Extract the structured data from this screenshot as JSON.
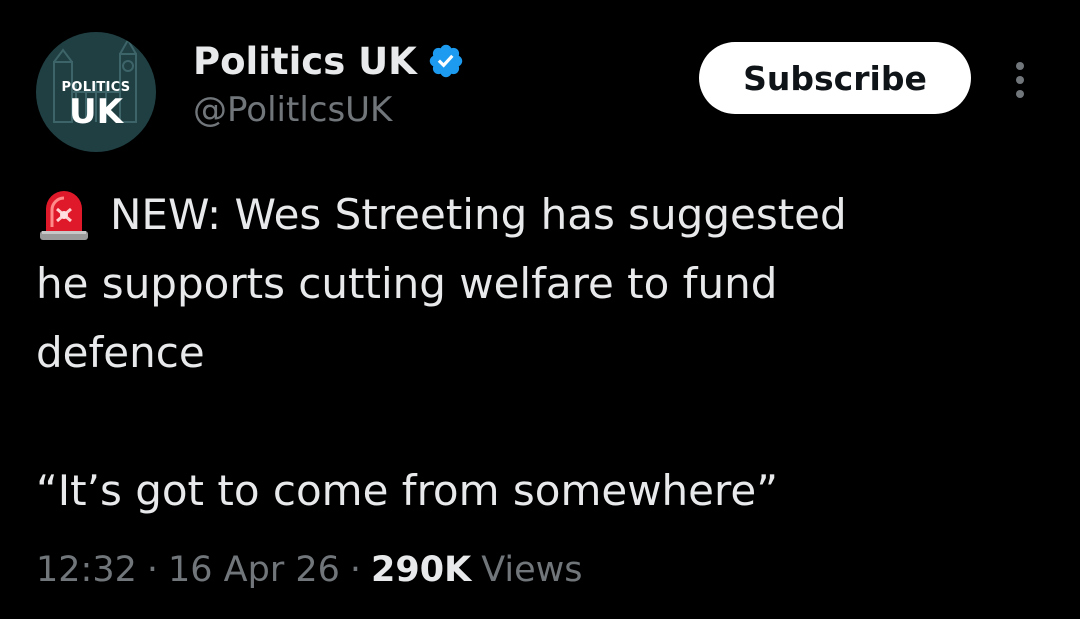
{
  "account": {
    "avatar_text_small": "POLITICS",
    "avatar_text_big": "UK",
    "display_name": "Politics UK",
    "handle": "@PolitlcsUK",
    "verified": true
  },
  "actions": {
    "subscribe_label": "Subscribe",
    "more_icon": "more-vertical-icon"
  },
  "tweet": {
    "lead_icon": "police-siren-icon",
    "lines": [
      "NEW: Wes Streeting has suggested",
      "he supports cutting welfare to fund",
      "defence",
      "“It’s got to come from somewhere”"
    ]
  },
  "meta": {
    "time": "12:32",
    "separator": "·",
    "date": "16 Apr 26",
    "views_count": "290K",
    "views_label": "Views"
  },
  "colors": {
    "background": "#000000",
    "text_primary": "#e7e9ea",
    "text_secondary": "#71767b",
    "verified": "#1d9bf0",
    "avatar_bg": "#1f3f43",
    "button_bg": "#ffffff"
  }
}
